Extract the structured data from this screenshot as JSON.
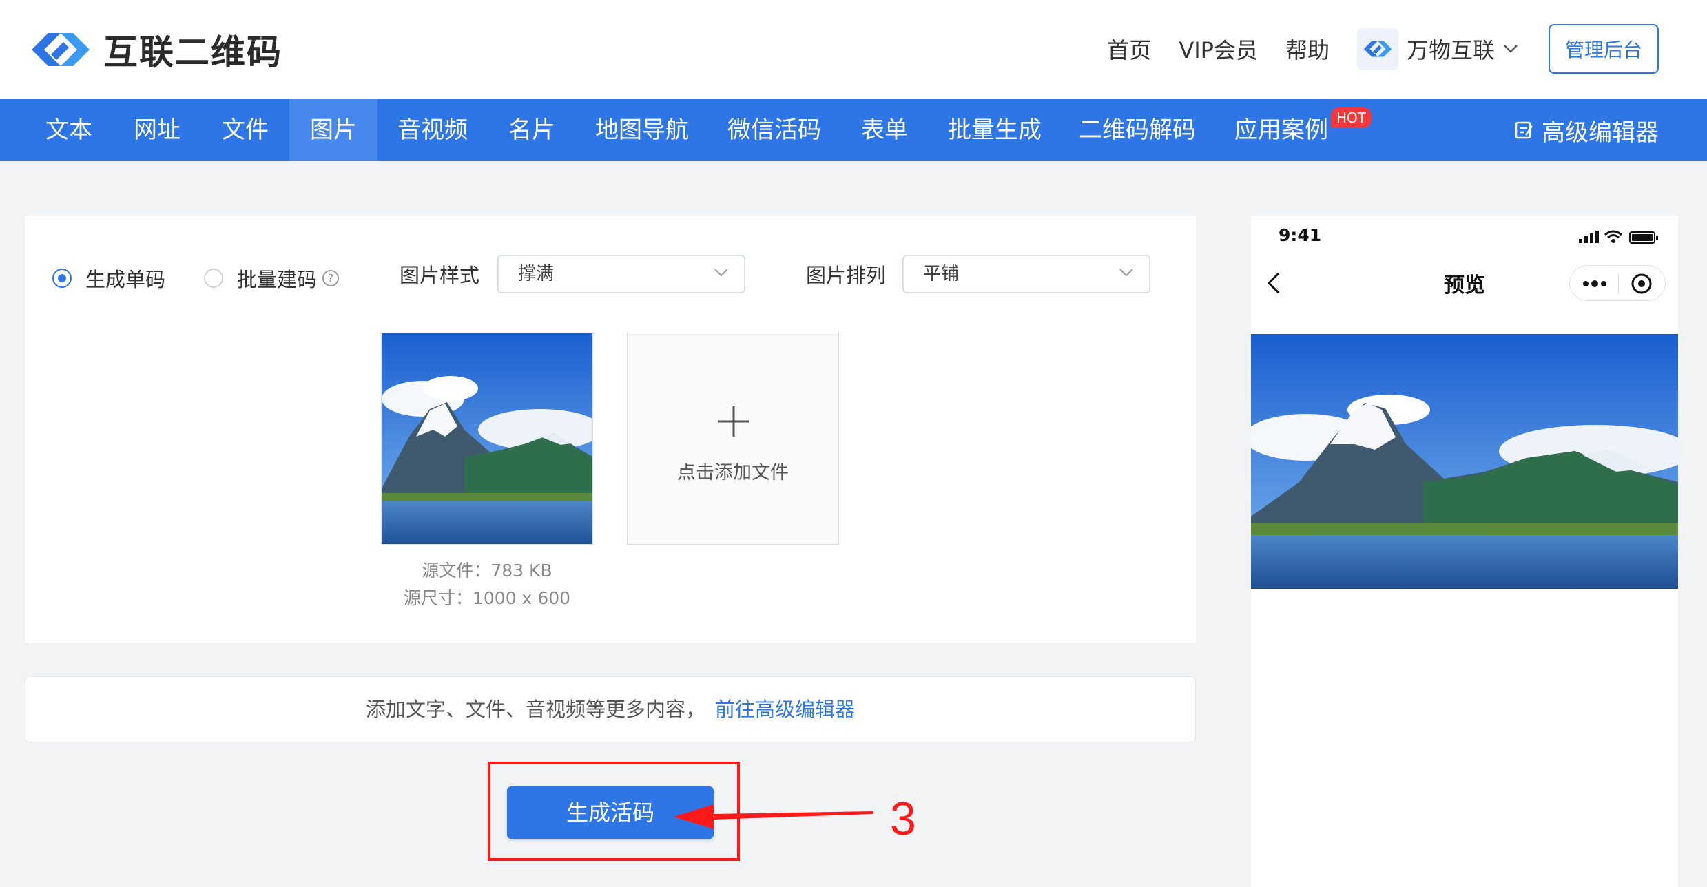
{
  "header": {
    "logo_text": "互联二维码",
    "links": [
      "首页",
      "VIP会员",
      "帮助"
    ],
    "brand_switch": "万物互联",
    "admin_button": "管理后台"
  },
  "nav": {
    "items": [
      "文本",
      "网址",
      "文件",
      "图片",
      "音视频",
      "名片",
      "地图导航",
      "微信活码",
      "表单",
      "批量生成",
      "二维码解码",
      "应用案例"
    ],
    "active": "图片",
    "hot_badge": "HOT",
    "advanced_editor": "高级编辑器"
  },
  "form": {
    "mode_single": "生成单码",
    "mode_batch": "批量建码",
    "help_icon": "?",
    "style_label": "图片样式",
    "style_value": "撑满",
    "arrange_label": "图片排列",
    "arrange_value": "平铺",
    "file_size": "源文件：783 KB",
    "file_dimensions": "源尺寸：1000 x 600",
    "add_file": "点击添加文件"
  },
  "info_bar": {
    "text": "添加文字、文件、音视频等更多内容，",
    "link": "前往高级编辑器"
  },
  "generate_button": "生成活码",
  "annotation": {
    "step_number": "3",
    "color": "#ff1a1a"
  },
  "preview": {
    "time": "9:41",
    "title": "预览"
  },
  "colors": {
    "primary": "#2e76e6",
    "nav_active": "#4688ee",
    "hot": "#f2383a"
  }
}
